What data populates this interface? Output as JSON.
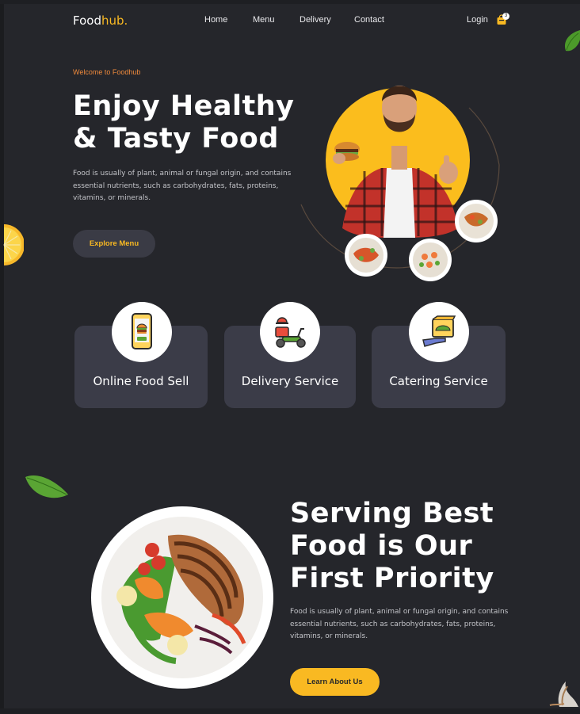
{
  "brand": {
    "name_main": "Food",
    "name_accent": "hub."
  },
  "nav": {
    "links": [
      {
        "label": "Home"
      },
      {
        "label": "Menu"
      },
      {
        "label": "Delivery"
      },
      {
        "label": "Contact"
      }
    ],
    "login_label": "Login",
    "cart_count": "3",
    "cart_icon": "shopping-bag-icon"
  },
  "hero": {
    "welcome": "Welcome to Foodhub",
    "title_line1": "Enjoy Healthy",
    "title_line2": "& Tasty Food",
    "description": "Food is usually of plant, animal or fungal origin, and contains essential nutrients, such as carbohydrates, fats, proteins, vitamins, or minerals.",
    "cta_label": "Explore Menu"
  },
  "services": [
    {
      "title": "Online Food Sell",
      "icon": "phone-burger-icon"
    },
    {
      "title": "Delivery Service",
      "icon": "scooter-delivery-icon"
    },
    {
      "title": "Catering Service",
      "icon": "food-box-hand-icon"
    }
  ],
  "about": {
    "title_line1": "Serving Best",
    "title_line2": "Food is Our",
    "title_line3": "First Priority",
    "description": "Food is usually of plant, animal or fungal origin, and contains essential nutrients, such as carbohydrates, fats, proteins, vitamins, or minerals.",
    "cta_label": "Learn About Us"
  },
  "colors": {
    "background": "#25262b",
    "accent": "#f9b922",
    "welcome": "#f08a3c",
    "card": "#3b3c48"
  }
}
